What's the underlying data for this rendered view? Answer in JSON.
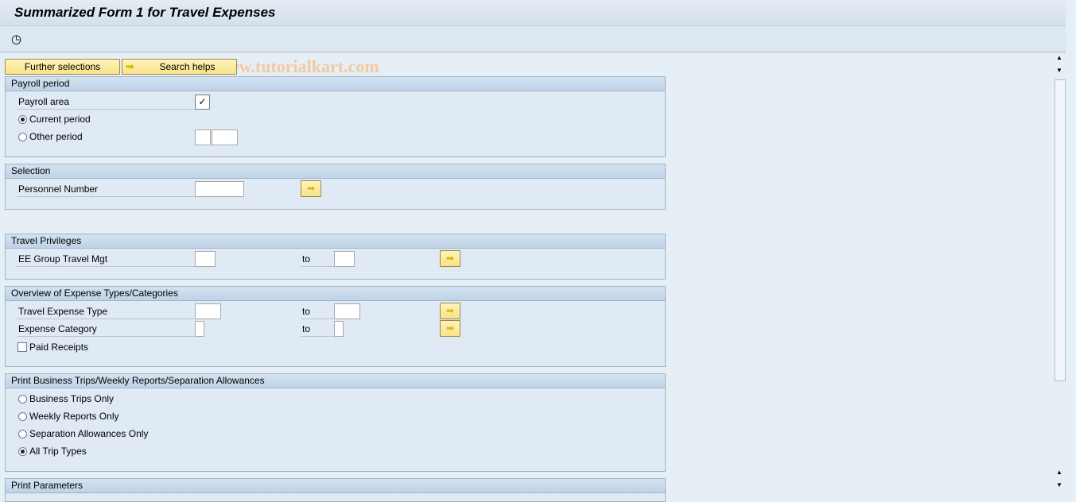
{
  "title": "Summarized Form 1 for Travel Expenses",
  "watermark": "© www.tutorialkart.com",
  "toolbar": {
    "execute_icon": "execute-clock-icon"
  },
  "buttons": {
    "further": "Further selections",
    "search": "Search helps"
  },
  "payroll": {
    "header": "Payroll period",
    "area": "Payroll area",
    "area_checked": true,
    "current": "Current period",
    "current_selected": true,
    "other": "Other period",
    "other_selected": false
  },
  "selection": {
    "header": "Selection",
    "pernr": "Personnel Number"
  },
  "privileges": {
    "header": "Travel Privileges",
    "group": "EE Group Travel Mgt",
    "to": "to"
  },
  "overview": {
    "header": "Overview of Expense Types/Categories",
    "type": "Travel Expense Type",
    "category": "Expense Category",
    "to": "to",
    "paid": "Paid Receipts",
    "paid_checked": false
  },
  "print": {
    "header": "Print Business Trips/Weekly Reports/Separation Allowances",
    "options": [
      "Business Trips Only",
      "Weekly Reports Only",
      "Separation Allowances Only",
      "All Trip Types"
    ],
    "selected": 3
  },
  "params": {
    "header": "Print Parameters"
  }
}
